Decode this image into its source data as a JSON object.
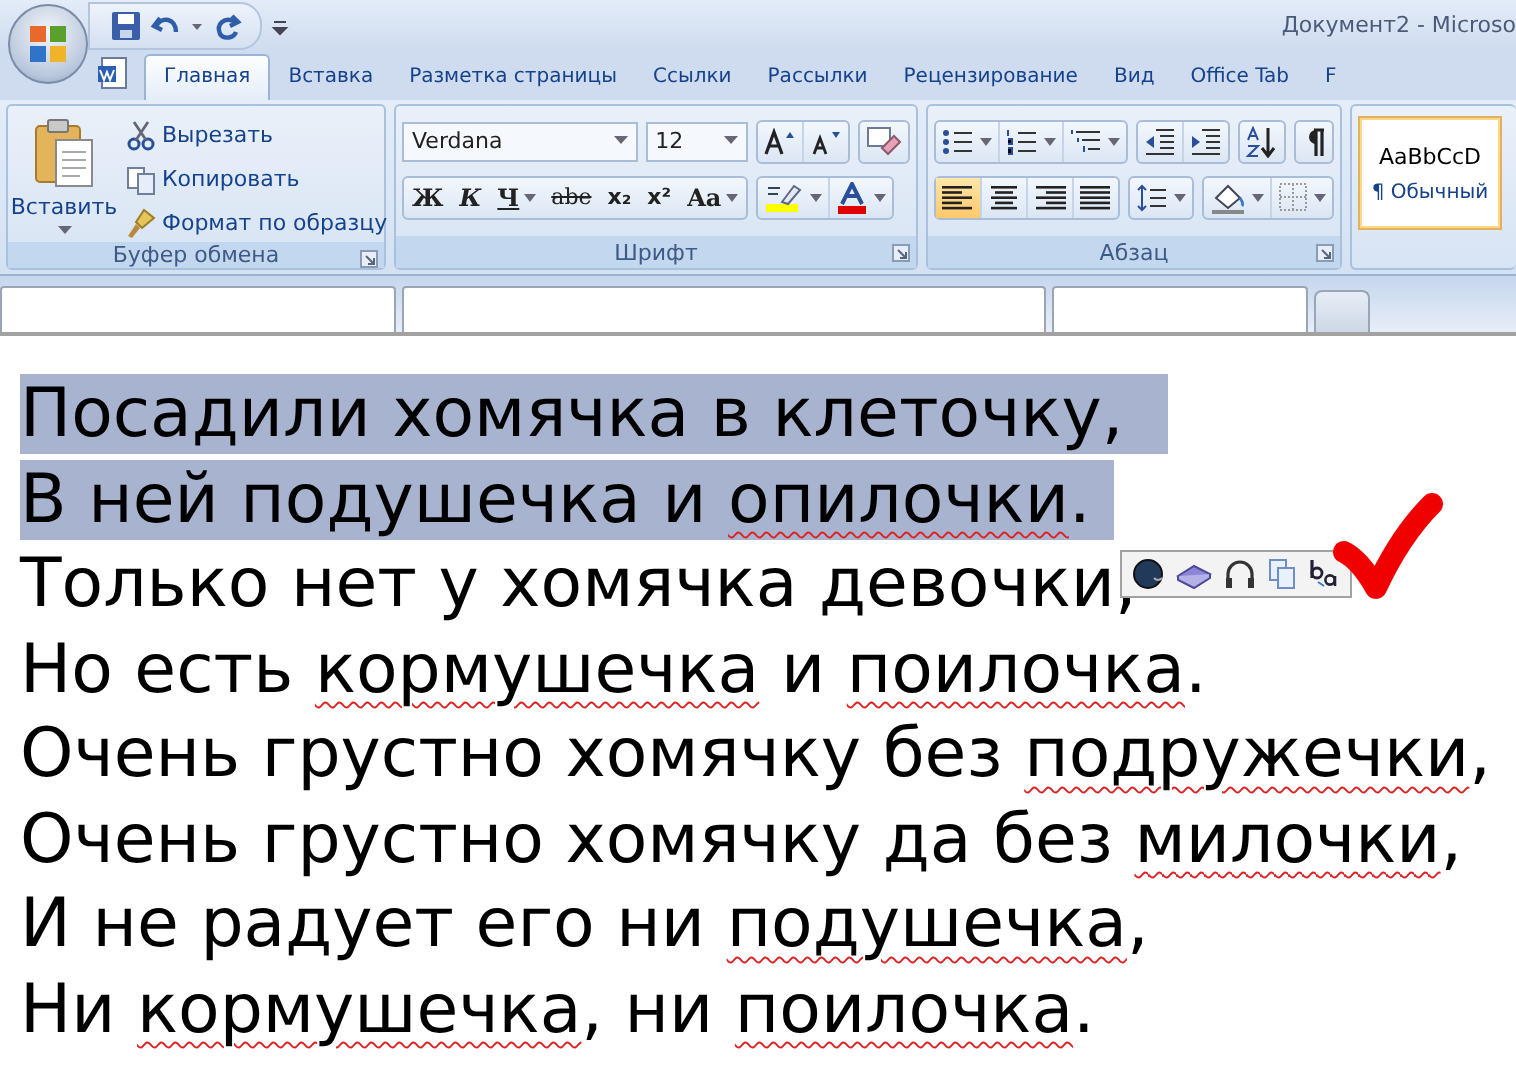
{
  "title_bar": {
    "title": "Документ2 - Microso"
  },
  "ribbon_tabs": [
    {
      "label": "Главная",
      "selected": true
    },
    {
      "label": "Вставка",
      "selected": false
    },
    {
      "label": "Разметка страницы",
      "selected": false
    },
    {
      "label": "Ссылки",
      "selected": false
    },
    {
      "label": "Рассылки",
      "selected": false
    },
    {
      "label": "Рецензирование",
      "selected": false
    },
    {
      "label": "Вид",
      "selected": false
    },
    {
      "label": "Office Tab",
      "selected": false
    },
    {
      "label": "F",
      "selected": false
    }
  ],
  "clipboard": {
    "paste": "Вставить",
    "commands": [
      {
        "label": "Вырезать",
        "kind": "cut"
      },
      {
        "label": "Копировать",
        "kind": "copy"
      },
      {
        "label": "Формат по образцу",
        "kind": "brush"
      }
    ],
    "group_label": "Буфер обмена"
  },
  "font": {
    "name": "Verdana",
    "size": "12",
    "format_buttons": [
      {
        "label": "Ж",
        "kind": "bold"
      },
      {
        "label": "К",
        "kind": "italic"
      },
      {
        "label": "Ч",
        "kind": "underline"
      },
      {
        "label": "abe",
        "kind": "strike"
      },
      {
        "label": "x₂",
        "kind": "sub"
      },
      {
        "label": "x²",
        "kind": "sup"
      },
      {
        "label": "Aa",
        "kind": "case"
      }
    ],
    "group_label": "Шрифт"
  },
  "paragraph": {
    "alignment": [
      {
        "kind": "left",
        "selected": true
      },
      {
        "kind": "center",
        "selected": false
      },
      {
        "kind": "right",
        "selected": false
      },
      {
        "kind": "justify",
        "selected": false
      }
    ],
    "group_label": "Абзац"
  },
  "styles": {
    "preview": "AaBbCcD",
    "name": "¶ Обычный"
  },
  "document": {
    "lines": [
      {
        "selected": true,
        "segments": [
          {
            "text": "Посадили хомячка в клеточку, ",
            "error": false
          }
        ]
      },
      {
        "selected": true,
        "segments": [
          {
            "text": "В ней подушечка и ",
            "error": false
          },
          {
            "text": "опилочки",
            "error": true
          },
          {
            "text": ".",
            "error": false
          }
        ]
      },
      {
        "selected": false,
        "segments": [
          {
            "text": "Только нет у хомячка девочки,",
            "error": false
          }
        ]
      },
      {
        "selected": false,
        "segments": [
          {
            "text": "Но есть ",
            "error": false
          },
          {
            "text": "кормушечка",
            "error": true
          },
          {
            "text": " и ",
            "error": false
          },
          {
            "text": "поилочка",
            "error": true
          },
          {
            "text": ".",
            "error": false
          }
        ]
      },
      {
        "selected": false,
        "segments": [
          {
            "text": "Очень грустно хомячку без ",
            "error": false
          },
          {
            "text": "подружечки",
            "error": true
          },
          {
            "text": ",",
            "error": false
          }
        ]
      },
      {
        "selected": false,
        "segments": [
          {
            "text": "Очень грустно хомячку да без ",
            "error": false
          },
          {
            "text": "милочки",
            "error": true
          },
          {
            "text": ",",
            "error": false
          }
        ]
      },
      {
        "selected": false,
        "segments": [
          {
            "text": "И не радует его ни ",
            "error": false
          },
          {
            "text": "подушечка",
            "error": true
          },
          {
            "text": ",",
            "error": false
          }
        ]
      },
      {
        "selected": false,
        "segments": [
          {
            "text": "Ни ",
            "error": false
          },
          {
            "text": "кормушечка",
            "error": true
          },
          {
            "text": ", ни ",
            "error": false
          },
          {
            "text": "поилочка",
            "error": true
          },
          {
            "text": ".",
            "error": false
          }
        ]
      }
    ]
  }
}
